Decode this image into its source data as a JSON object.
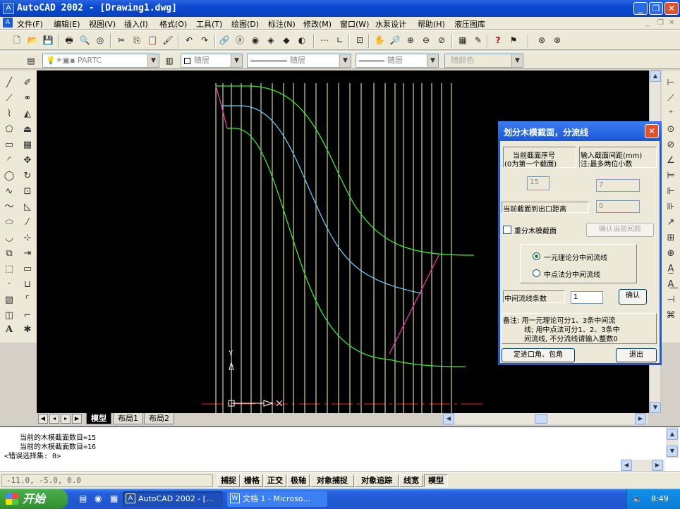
{
  "window": {
    "title": "AutoCAD 2002 - [Drawing1.dwg]"
  },
  "menu": [
    "文件(F)",
    "编辑(E)",
    "视图(V)",
    "插入(I)",
    "格式(O)",
    "工具(T)",
    "绘图(D)",
    "标注(N)",
    "修改(M)",
    "窗口(W)",
    "水泵设计",
    "帮助(H)",
    "液压图库"
  ],
  "layer_toolbar": {
    "layer_name": "PARTC",
    "color_combo": "随层",
    "linetype_combo": "随层",
    "lineweight_combo": "随层",
    "plotstyle_combo": "随颜色"
  },
  "tabs": {
    "model": "模型",
    "layout1": "布局1",
    "layout2": "布局2"
  },
  "canvas": {
    "ucs_x": "X",
    "ucs_y": "Y"
  },
  "dialog": {
    "title": "划分木模截面，分流线",
    "current_section_label": "当前截面序号",
    "current_section_hint": "(0为第一个截面)",
    "spacing_label": "输入截面间距(mm)",
    "spacing_hint": "注:最多两位小数",
    "current_section_value": "15",
    "spacing_value": "7",
    "distance_label": "当前截面到出口距离",
    "distance_value": "0",
    "redivide_label": "重分木模截面",
    "confirm_spacing_button": "确认当前间距",
    "radio_1d": "一元理论分中间流线",
    "radio_mid": "中点法分中间流线",
    "streamline_count_label": "中间流线条数",
    "streamline_count_value": "1",
    "confirm_button": "确认",
    "note_line1": "备注: 用一元理论可分1、3条中间流",
    "note_line2": "线; 用中点法可分1、2、3条中",
    "note_line3": "间流线, 不分流线请输入整数0",
    "inlet_button": "定进口角、包角",
    "exit_button": "退出"
  },
  "command": {
    "line1": "当前的木模截面数目=15",
    "line2": "当前的木模截面数目=16",
    "line3": "<错误选择集: 0>"
  },
  "status": {
    "coords": "-11.0, -5.0, 0.0",
    "buttons": [
      "捕捉",
      "栅格",
      "正交",
      "极轴",
      "对象捕捉",
      "对象追踪",
      "线宽",
      "模型"
    ]
  },
  "taskbar": {
    "start": "开始",
    "task1": "AutoCAD 2002 - [...",
    "task2": "文档 1 - Microso...",
    "clock": "8:49"
  },
  "colors": {
    "title_blue": "#0a4ad0",
    "canvas_bg": "#000000",
    "vertical_lines": "#ffff99",
    "curve_green": "#33ee33",
    "curve_cyan": "#66ccff",
    "curve_magenta": "#ff33cc",
    "axis_red": "#ff2020"
  }
}
